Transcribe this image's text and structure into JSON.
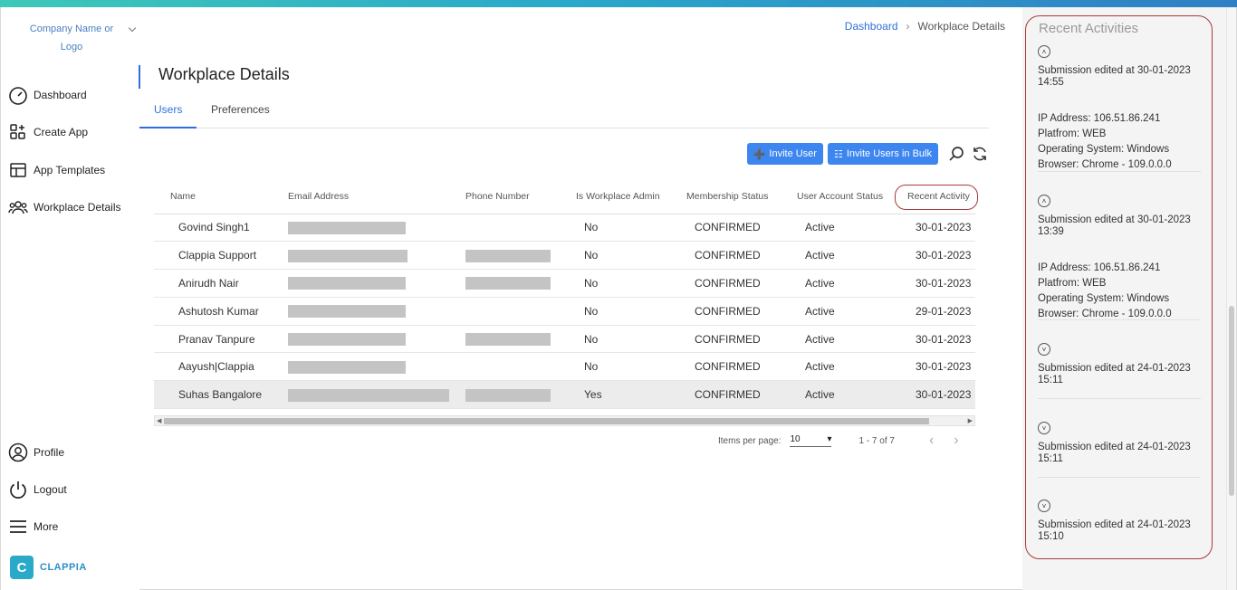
{
  "sidebar": {
    "company": [
      "Company Name or",
      "Logo"
    ],
    "nav": [
      {
        "label": "Dashboard",
        "icon": "speedometer-icon"
      },
      {
        "label": "Create App",
        "icon": "create-app-icon"
      },
      {
        "label": "App Templates",
        "icon": "templates-icon"
      },
      {
        "label": "Workplace Details",
        "icon": "team-icon"
      }
    ],
    "bottom": [
      {
        "label": "Profile",
        "icon": "user-circle-icon"
      },
      {
        "label": "Logout",
        "icon": "power-icon"
      },
      {
        "label": "More",
        "icon": "menu-icon"
      }
    ],
    "brand": "CLAPPIA"
  },
  "breadcrumb": {
    "home": "Dashboard",
    "current": "Workplace Details"
  },
  "page": {
    "title": "Workplace Details"
  },
  "tabs": [
    {
      "label": "Users",
      "active": true
    },
    {
      "label": "Preferences",
      "active": false
    }
  ],
  "toolbar": {
    "invite_user": "Invite User",
    "invite_bulk": "Invite Users in Bulk"
  },
  "table": {
    "columns": [
      "Name",
      "Email Address",
      "Phone Number",
      "Is Workplace Admin",
      "Membership Status",
      "User Account Status",
      "Recent Activity"
    ],
    "rows": [
      {
        "name": "Govind Singh1",
        "admin": "No",
        "membership": "CONFIRMED",
        "account": "Active",
        "recent": "30-01-2023",
        "phone": false
      },
      {
        "name": "Clappia Support",
        "admin": "No",
        "membership": "CONFIRMED",
        "account": "Active",
        "recent": "30-01-2023",
        "phone": true
      },
      {
        "name": "Anirudh Nair",
        "admin": "No",
        "membership": "CONFIRMED",
        "account": "Active",
        "recent": "30-01-2023",
        "phone": true
      },
      {
        "name": "Ashutosh Kumar",
        "admin": "No",
        "membership": "CONFIRMED",
        "account": "Active",
        "recent": "29-01-2023",
        "phone": false
      },
      {
        "name": "Pranav Tanpure",
        "admin": "No",
        "membership": "CONFIRMED",
        "account": "Active",
        "recent": "30-01-2023",
        "phone": true
      },
      {
        "name": "Aayush|Clappia",
        "admin": "No",
        "membership": "CONFIRMED",
        "account": "Active",
        "recent": "30-01-2023",
        "phone": false
      },
      {
        "name": "Suhas Bangalore",
        "admin": "Yes",
        "membership": "CONFIRMED",
        "account": "Active",
        "recent": "30-01-2023",
        "phone": true,
        "selected": true
      }
    ]
  },
  "paginator": {
    "label": "Items per page:",
    "value": "10",
    "range": "1 - 7 of 7"
  },
  "panel": {
    "title": "Recent Activities",
    "items": [
      {
        "expanded": true,
        "text": "Submission edited at 30-01-2023 14:55",
        "meta": [
          "IP Address: 106.51.86.241",
          "Platfrom: WEB",
          "Operating System: Windows",
          "Browser: Chrome - 109.0.0.0"
        ]
      },
      {
        "expanded": true,
        "text": "Submission edited at 30-01-2023 13:39",
        "meta": [
          "IP Address: 106.51.86.241",
          "Platfrom: WEB",
          "Operating System: Windows",
          "Browser: Chrome - 109.0.0.0"
        ]
      },
      {
        "expanded": false,
        "text": "Submission edited at 24-01-2023 15:11"
      },
      {
        "expanded": false,
        "text": "Submission edited at 24-01-2023 15:11"
      },
      {
        "expanded": false,
        "text": "Submission edited at 24-01-2023 15:10"
      }
    ]
  },
  "colors": {
    "accent": "#2f6fdc",
    "button": "#3d86f0",
    "highlight_ring": "#a83a3a"
  }
}
